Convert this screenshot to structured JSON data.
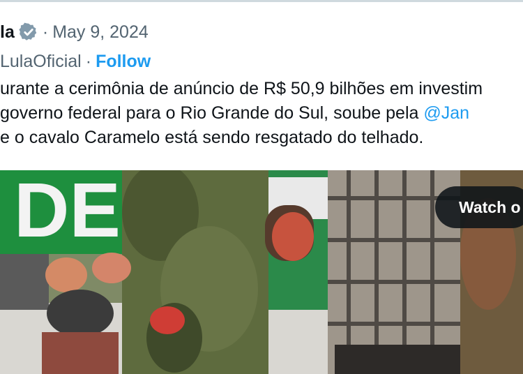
{
  "tweet": {
    "author_name_partial": "la",
    "date_separator": "·",
    "date": "May 9, 2024",
    "handle_partial": "LulaOficial",
    "handle_separator": "·",
    "follow_label": "Follow",
    "text_lines": [
      {
        "pre": "urante a cerimônia de anúncio de R$ 50,9 bilhões em investim",
        "mention": "",
        "post": ""
      },
      {
        "pre": " governo federal para o Rio Grande do Sul, soube pela ",
        "mention": "@Jan",
        "post": ""
      },
      {
        "pre": "e o cavalo Caramelo está sendo resgatado do telhado.",
        "mention": "",
        "post": ""
      }
    ]
  },
  "media": {
    "watch_label": "Watch o",
    "sign_letters": "DE"
  },
  "colors": {
    "link_blue": "#1d9bf0",
    "secondary_gray": "#536471",
    "verified_gray": "#829aab",
    "sign_green": "#1e8f3e"
  }
}
